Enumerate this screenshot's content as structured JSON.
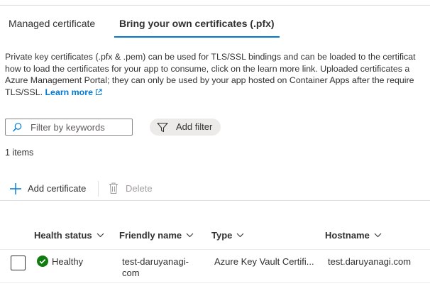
{
  "tabs": [
    {
      "label": "Managed certificate",
      "selected": false
    },
    {
      "label": "Bring your own certificates (.pfx)",
      "selected": true
    }
  ],
  "description": {
    "line1": "Private key certificates (.pfx & .pem) can be used for TLS/SSL bindings and can be loaded to the certificat",
    "line2": "how to load the certificates for your app to consume, click on the learn more link. Uploaded certificates a",
    "line3": "Azure Management Portal; they can only be used by your app hosted on Container Apps after the require",
    "line4": "TLS/SSL.",
    "learn_more": "Learn more"
  },
  "filter": {
    "placeholder": "Filter by keywords",
    "value": ""
  },
  "add_filter_label": "Add filter",
  "items_count": "1 items",
  "toolbar": {
    "add_label": "Add certificate",
    "delete_label": "Delete"
  },
  "table": {
    "columns": [
      "Health status",
      "Friendly name",
      "Type",
      "Hostname"
    ],
    "rows": [
      {
        "health": "Healthy",
        "friendly_name": "test-daruyanagi-com",
        "type": "Azure Key Vault Certifi...",
        "hostname": "test.daruyanagi.com"
      }
    ]
  },
  "colors": {
    "accent": "#0078d4",
    "healthy": "#107c10",
    "text": "#323130",
    "disabled": "#a19f9d"
  }
}
